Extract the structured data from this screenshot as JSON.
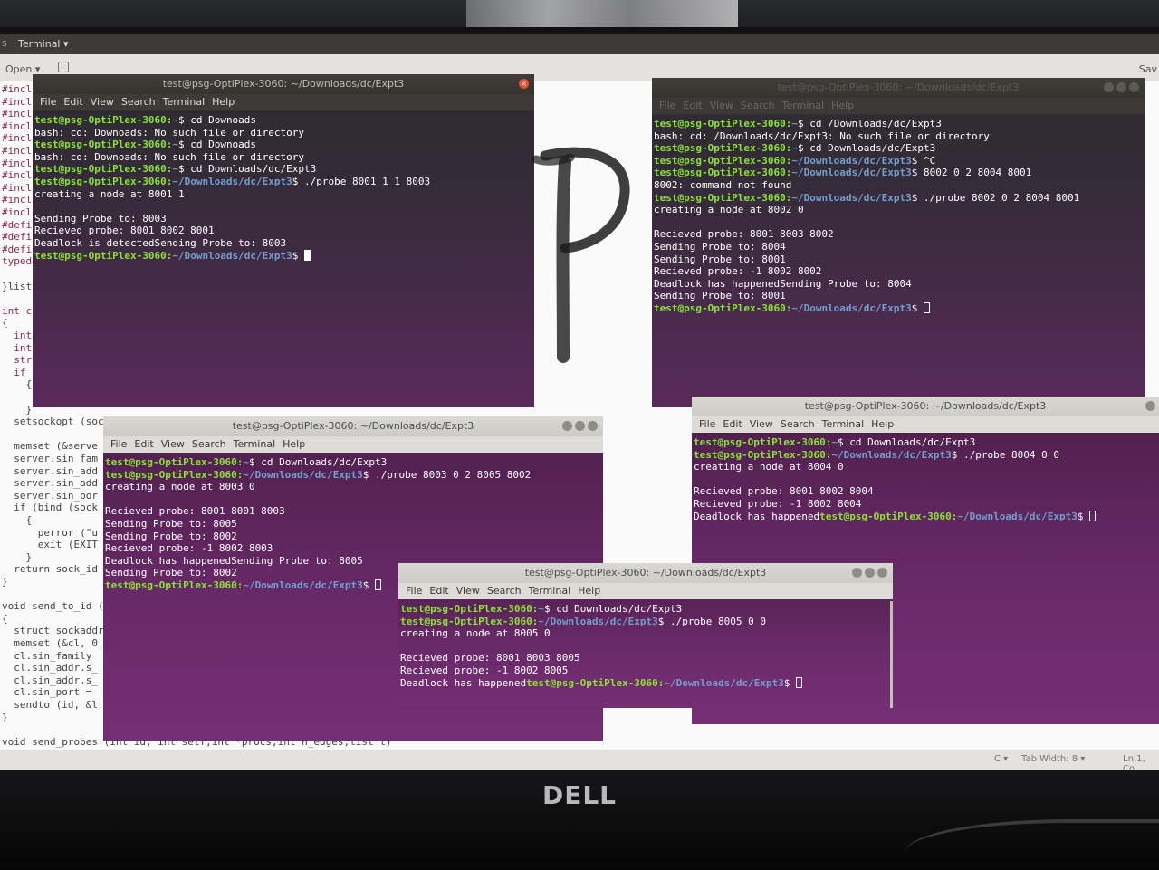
{
  "monitor": {
    "brand": "DELL"
  },
  "desktop": {
    "top_panel": {
      "app_label": "Terminal ▾"
    },
    "editor_toolbar": {
      "open_label": "Open ▾",
      "right_text": "Sav"
    },
    "code_lines": [
      {
        "text": "#inclu",
        "kw": true
      },
      {
        "text": "#inclu",
        "kw": true
      },
      {
        "text": "#inclu",
        "kw": true
      },
      {
        "text": "#inclu",
        "kw": true
      },
      {
        "text": "#inclu",
        "kw": true
      },
      {
        "text": "#inclu",
        "kw": true
      },
      {
        "text": "#inclu",
        "kw": true
      },
      {
        "text": "#inclu",
        "kw": true
      },
      {
        "text": "#inclu",
        "kw": true
      },
      {
        "text": "#inclu",
        "kw": true
      },
      {
        "text": "#inclu",
        "kw": true
      },
      {
        "text": "#defin",
        "kw": true
      },
      {
        "text": "#defin",
        "kw": true
      },
      {
        "text": "#defin",
        "kw": true
      },
      {
        "text": "typede",
        "kw": true
      },
      {
        "text": "",
        "kw": false
      },
      {
        "text": "}list;",
        "kw": false
      },
      {
        "text": "",
        "kw": false
      },
      {
        "text": "int co",
        "kw": true
      },
      {
        "text": "{",
        "kw": false
      },
      {
        "text": "  int",
        "kw": true
      },
      {
        "text": "  int",
        "kw": true
      },
      {
        "text": "  stru",
        "kw": true
      },
      {
        "text": "  if (",
        "kw": true
      },
      {
        "text": "    {",
        "kw": false
      },
      {
        "text": "      exit (EXIT_FAILURE);",
        "kw": false
      },
      {
        "text": "    }",
        "kw": false
      },
      {
        "text": "  setsockopt (soc",
        "kw": false
      },
      {
        "text": "",
        "kw": false
      },
      {
        "text": "  memset (&serve",
        "kw": false
      },
      {
        "text": "  server.sin_fam",
        "kw": false
      },
      {
        "text": "  server.sin_add",
        "kw": false
      },
      {
        "text": "  server.sin_add",
        "kw": false
      },
      {
        "text": "  server.sin_por",
        "kw": false
      },
      {
        "text": "  if (bind (sock",
        "kw": false
      },
      {
        "text": "    {",
        "kw": false
      },
      {
        "text": "      perror (\"u",
        "kw": false
      },
      {
        "text": "      exit (EXIT",
        "kw": false
      },
      {
        "text": "    }",
        "kw": false
      },
      {
        "text": "  return sock_id",
        "kw": false
      },
      {
        "text": "}",
        "kw": false
      },
      {
        "text": "",
        "kw": false
      },
      {
        "text": "void send_to_id (",
        "kw": false
      },
      {
        "text": "{",
        "kw": false
      },
      {
        "text": "  struct sockaddr",
        "kw": false
      },
      {
        "text": "  memset (&cl, 0",
        "kw": false
      },
      {
        "text": "  cl.sin_family",
        "kw": false
      },
      {
        "text": "  cl.sin_addr.s_",
        "kw": false
      },
      {
        "text": "  cl.sin_addr.s_",
        "kw": false
      },
      {
        "text": "  cl.sin_port =",
        "kw": false
      },
      {
        "text": "  sendto (id, &l",
        "kw": false
      },
      {
        "text": "}",
        "kw": false
      },
      {
        "text": "",
        "kw": false
      },
      {
        "text": "void send_probes (int id, int self,int *procs,int n_edges,list l)",
        "kw": false
      }
    ],
    "status_bar": {
      "language": "C ▾",
      "tab_width": "Tab Width: 8 ▾",
      "position": "Ln 1, Co"
    }
  },
  "terminals": [
    {
      "title": "test@psg-OptiPlex-3060: ~/Downloads/dc/Expt3",
      "menu": [
        "File",
        "Edit",
        "View",
        "Search",
        "Terminal",
        "Help"
      ],
      "lines": [
        {
          "user": "test@psg-OptiPlex-3060",
          "path": "~",
          "cmd": "cd Downoads"
        },
        {
          "text": "bash: cd: Downoads: No such file or directory"
        },
        {
          "user": "test@psg-OptiPlex-3060",
          "path": "~",
          "cmd": "cd Downoads"
        },
        {
          "text": "bash: cd: Downoads: No such file or directory"
        },
        {
          "user": "test@psg-OptiPlex-3060",
          "path": "~",
          "cmd": "cd Downloads/dc/Expt3"
        },
        {
          "user": "test@psg-OptiPlex-3060",
          "path": "~/Downloads/dc/Expt3",
          "cmd": "./probe 8001 1 1 8003"
        },
        {
          "text": "creating a node at 8001 1"
        },
        {
          "text": ""
        },
        {
          "text": "Sending Probe to: 8003"
        },
        {
          "text": "Recieved probe: 8001 8002 8001"
        },
        {
          "text": "Deadlock is detectedSending Probe to: 8003"
        },
        {
          "user": "test@psg-OptiPlex-3060",
          "path": "~/Downloads/dc/Expt3",
          "cmd": "",
          "cursor": "solid"
        }
      ]
    },
    {
      "title": "test@psg-OptiPlex-3060: ~/Downloads/dc/Expt3",
      "menu": [
        "File",
        "Edit",
        "View",
        "Search",
        "Terminal",
        "Help"
      ],
      "lines": [
        {
          "user": "test@psg-OptiPlex-3060",
          "path": "~",
          "cmd": "cd /Downloads/dc/Expt3"
        },
        {
          "text": "bash: cd: /Downloads/dc/Expt3: No such file or directory"
        },
        {
          "user": "test@psg-OptiPlex-3060",
          "path": "~",
          "cmd": "cd Downloads/dc/Expt3"
        },
        {
          "user": "test@psg-OptiPlex-3060",
          "path": "~/Downloads/dc/Expt3",
          "cmd": "^C"
        },
        {
          "user": "test@psg-OptiPlex-3060",
          "path": "~/Downloads/dc/Expt3",
          "cmd": "8002 0 2 8004 8001"
        },
        {
          "text": "8002: command not found"
        },
        {
          "user": "test@psg-OptiPlex-3060",
          "path": "~/Downloads/dc/Expt3",
          "cmd": "./probe 8002 0 2 8004 8001"
        },
        {
          "text": "creating a node at 8002 0"
        },
        {
          "text": ""
        },
        {
          "text": "Recieved probe: 8001 8003 8002"
        },
        {
          "text": "Sending Probe to: 8004"
        },
        {
          "text": "Sending Probe to: 8001"
        },
        {
          "text": "Recieved probe: -1 8002 8002"
        },
        {
          "text": "Deadlock has happenedSending Probe to: 8004"
        },
        {
          "text": "Sending Probe to: 8001"
        },
        {
          "user": "test@psg-OptiPlex-3060",
          "path": "~/Downloads/dc/Expt3",
          "cmd": "",
          "cursor": "hollow"
        }
      ]
    },
    {
      "title": "test@psg-OptiPlex-3060: ~/Downloads/dc/Expt3",
      "menu": [
        "File",
        "Edit",
        "View",
        "Search",
        "Terminal",
        "Help"
      ],
      "lines": [
        {
          "user": "test@psg-OptiPlex-3060",
          "path": "~",
          "cmd": "cd Downloads/dc/Expt3"
        },
        {
          "user": "test@psg-OptiPlex-3060",
          "path": "~/Downloads/dc/Expt3",
          "cmd": "./probe 8003 0 2 8005 8002"
        },
        {
          "text": "creating a node at 8003 0"
        },
        {
          "text": ""
        },
        {
          "text": "Recieved probe: 8001 8001 8003"
        },
        {
          "text": "Sending Probe to: 8005"
        },
        {
          "text": "Sending Probe to: 8002"
        },
        {
          "text": "Recieved probe: -1 8002 8003"
        },
        {
          "text": "Deadlock has happenedSending Probe to: 8005"
        },
        {
          "text": "Sending Probe to: 8002"
        },
        {
          "user": "test@psg-OptiPlex-3060",
          "path": "~/Downloads/dc/Expt3",
          "cmd": "",
          "cursor": "hollow"
        }
      ]
    },
    {
      "title": "test@psg-OptiPlex-3060: ~/Downloads/dc/Expt3",
      "menu": [
        "File",
        "Edit",
        "View",
        "Search",
        "Terminal",
        "Help"
      ],
      "lines": [
        {
          "user": "test@psg-OptiPlex-3060",
          "path": "~",
          "cmd": "cd Downloads/dc/Expt3"
        },
        {
          "user": "test@psg-OptiPlex-3060",
          "path": "~/Downloads/dc/Expt3",
          "cmd": "./probe 8004 0 0"
        },
        {
          "text": "creating a node at 8004 0"
        },
        {
          "text": ""
        },
        {
          "text": "Recieved probe: 8001 8002 8004"
        },
        {
          "text": "Recieved probe: -1 8002 8004"
        },
        {
          "text": "Deadlock has happened",
          "user": "test@psg-OptiPlex-3060",
          "path": "~/Downloads/dc/Expt3",
          "cmd": "",
          "cursor": "hollow"
        }
      ]
    },
    {
      "title": "test@psg-OptiPlex-3060: ~/Downloads/dc/Expt3",
      "menu": [
        "File",
        "Edit",
        "View",
        "Search",
        "Terminal",
        "Help"
      ],
      "lines": [
        {
          "user": "test@psg-OptiPlex-3060",
          "path": "~",
          "cmd": "cd Downloads/dc/Expt3"
        },
        {
          "user": "test@psg-OptiPlex-3060",
          "path": "~/Downloads/dc/Expt3",
          "cmd": "./probe 8005 0 0"
        },
        {
          "text": "creating a node at 8005 0"
        },
        {
          "text": ""
        },
        {
          "text": "Recieved probe: 8001 8003 8005"
        },
        {
          "text": "Recieved probe: -1 8002 8005"
        },
        {
          "text": "Deadlock has happened",
          "user": "test@psg-OptiPlex-3060",
          "path": "~/Downloads/dc/Expt3",
          "cmd": "",
          "cursor": "hollow"
        }
      ]
    }
  ]
}
